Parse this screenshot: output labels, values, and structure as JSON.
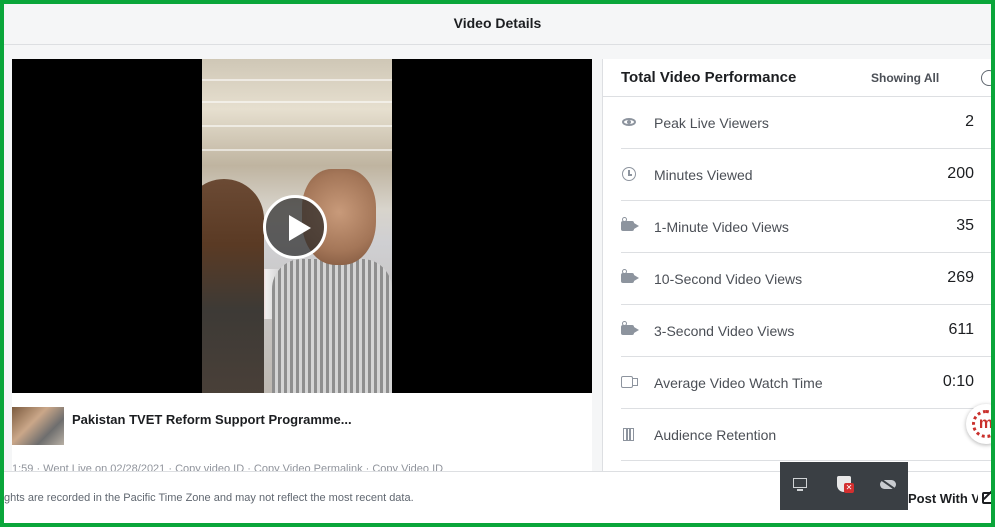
{
  "header": {
    "title": "Video Details"
  },
  "video": {
    "title": "Pakistan TVET Reform Support Programme...",
    "meta": "1:59 · Went Live on 02/28/2021 · Copy video ID · Copy Video Permalink · Copy Video ID"
  },
  "performance": {
    "title": "Total Video Performance",
    "filter_label": "Showing All",
    "metrics": [
      {
        "icon": "eye-icon",
        "label": "Peak Live Viewers",
        "value": "2"
      },
      {
        "icon": "clock-icon",
        "label": "Minutes Viewed",
        "value": "200"
      },
      {
        "icon": "video-camera-icon",
        "label": "1-Minute Video Views",
        "value": "35"
      },
      {
        "icon": "video-camera-icon",
        "label": "10-Second Video Views",
        "value": "269"
      },
      {
        "icon": "video-camera-icon",
        "label": "3-Second Video Views",
        "value": "611"
      },
      {
        "icon": "video-recorder-icon",
        "label": "Average Video Watch Time",
        "value": "0:10"
      },
      {
        "icon": "film-strip-icon",
        "label": "Audience Retention",
        "value": ""
      }
    ]
  },
  "footer": {
    "note": "ghts are recorded in the Pacific Time Zone and may not reflect the most recent data.",
    "post_button_label": "Post With V"
  },
  "colors": {
    "frame_border": "#0aa63a",
    "panel_bg": "#ffffff",
    "page_bg": "#f5f6f7",
    "tray_bg": "#3a3f44"
  }
}
